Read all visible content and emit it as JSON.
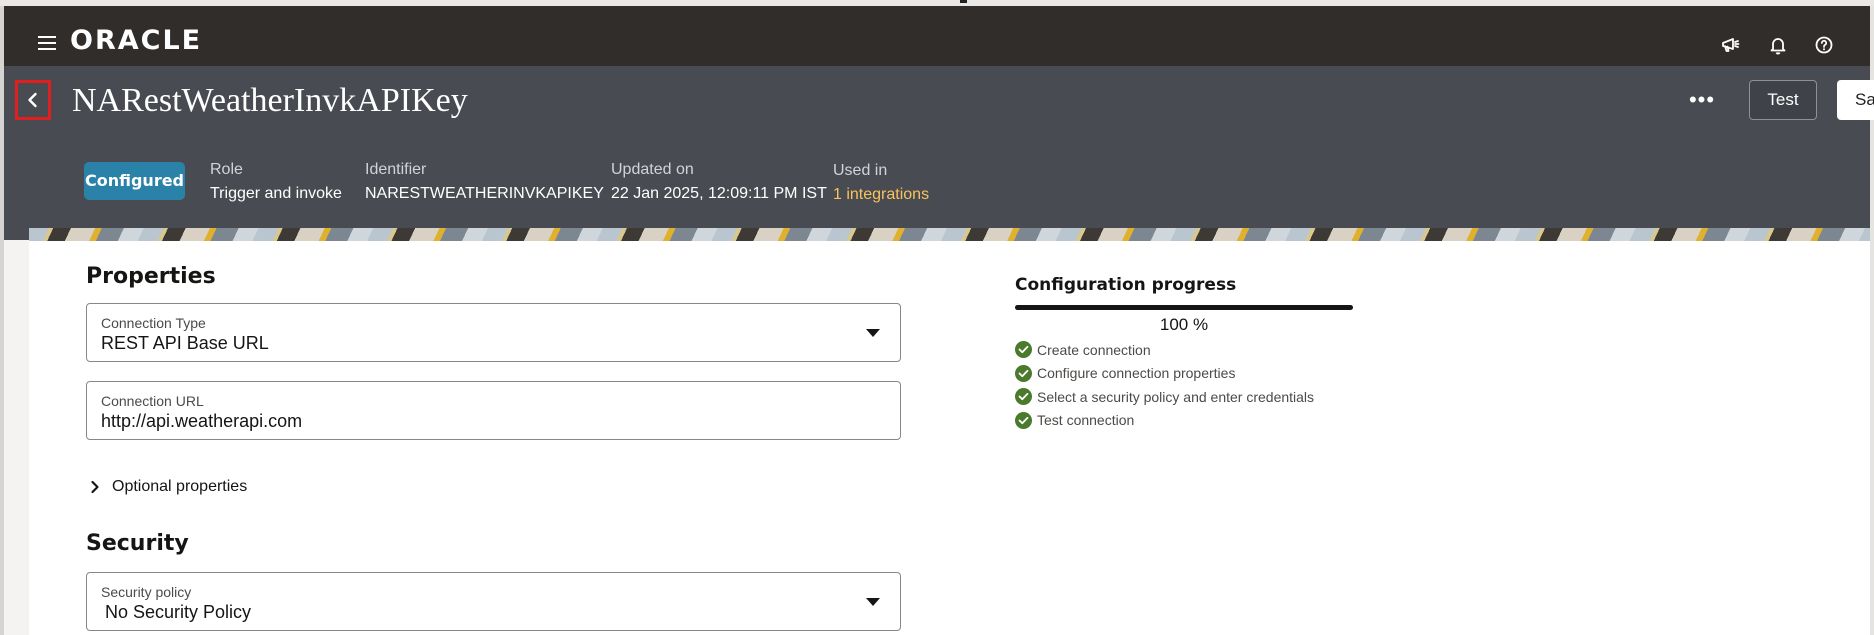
{
  "topbar": {
    "brand": "ORACLE",
    "icons": [
      "menu-icon",
      "megaphone-icon",
      "bell-icon",
      "help-icon"
    ]
  },
  "header": {
    "title": "NARestWeatherInvkAPIKey",
    "more_label": "•••",
    "test_label": "Test",
    "save_label": "Sa",
    "status_badge": "Configured",
    "meta": {
      "role": {
        "label": "Role",
        "value": "Trigger and invoke"
      },
      "identifier": {
        "label": "Identifier",
        "value": "NARESTWEATHERINVKAPIKEY"
      },
      "updated": {
        "label": "Updated on",
        "value": "22 Jan 2025, 12:09:11 PM IST"
      },
      "used_in": {
        "label": "Used in",
        "value": "1 integrations"
      }
    }
  },
  "properties": {
    "title": "Properties",
    "connection_type": {
      "label": "Connection Type",
      "value": "REST API Base URL"
    },
    "connection_url": {
      "label": "Connection URL",
      "value": "http://api.weatherapi.com"
    },
    "optional_label": "Optional properties"
  },
  "security": {
    "title": "Security",
    "policy": {
      "label": "Security policy",
      "value": "No Security Policy"
    }
  },
  "progress": {
    "title": "Configuration progress",
    "percent_text": "100 %",
    "fraction": 1.0,
    "steps": [
      {
        "label": "Create connection",
        "done": true
      },
      {
        "label": "Configure connection properties",
        "done": true
      },
      {
        "label": "Select a security policy and enter credentials",
        "done": true
      },
      {
        "label": "Test connection",
        "done": true
      }
    ]
  },
  "colors": {
    "topbar": "#312d2a",
    "header": "#484b51",
    "badge": "#2a82a8",
    "link": "#f7c35b",
    "check": "#4a7a2c",
    "highlight": "#e0201e"
  }
}
